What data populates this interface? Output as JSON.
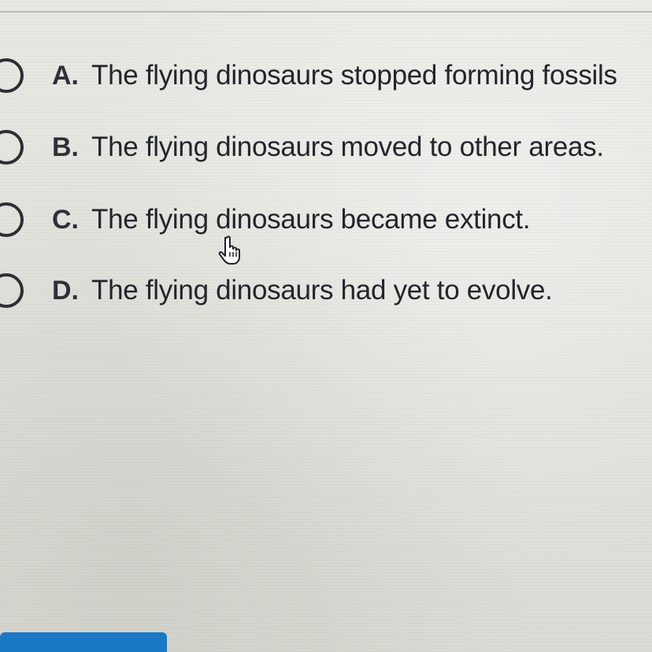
{
  "question": {
    "options": [
      {
        "letter": "A.",
        "text": "The flying dinosaurs stopped forming fossils"
      },
      {
        "letter": "B.",
        "text": "The flying dinosaurs moved to other areas."
      },
      {
        "letter": "C.",
        "text": "The flying dinosaurs became extinct."
      },
      {
        "letter": "D.",
        "text": "The flying dinosaurs had yet to evolve."
      }
    ]
  },
  "icons": {
    "radio": "radio-unselected-icon",
    "cursor": "hand-pointer-icon"
  },
  "colors": {
    "text": "#22252c",
    "radio_border": "#2d2f35",
    "button": "#1b78c4",
    "background": "#e4e4df"
  }
}
